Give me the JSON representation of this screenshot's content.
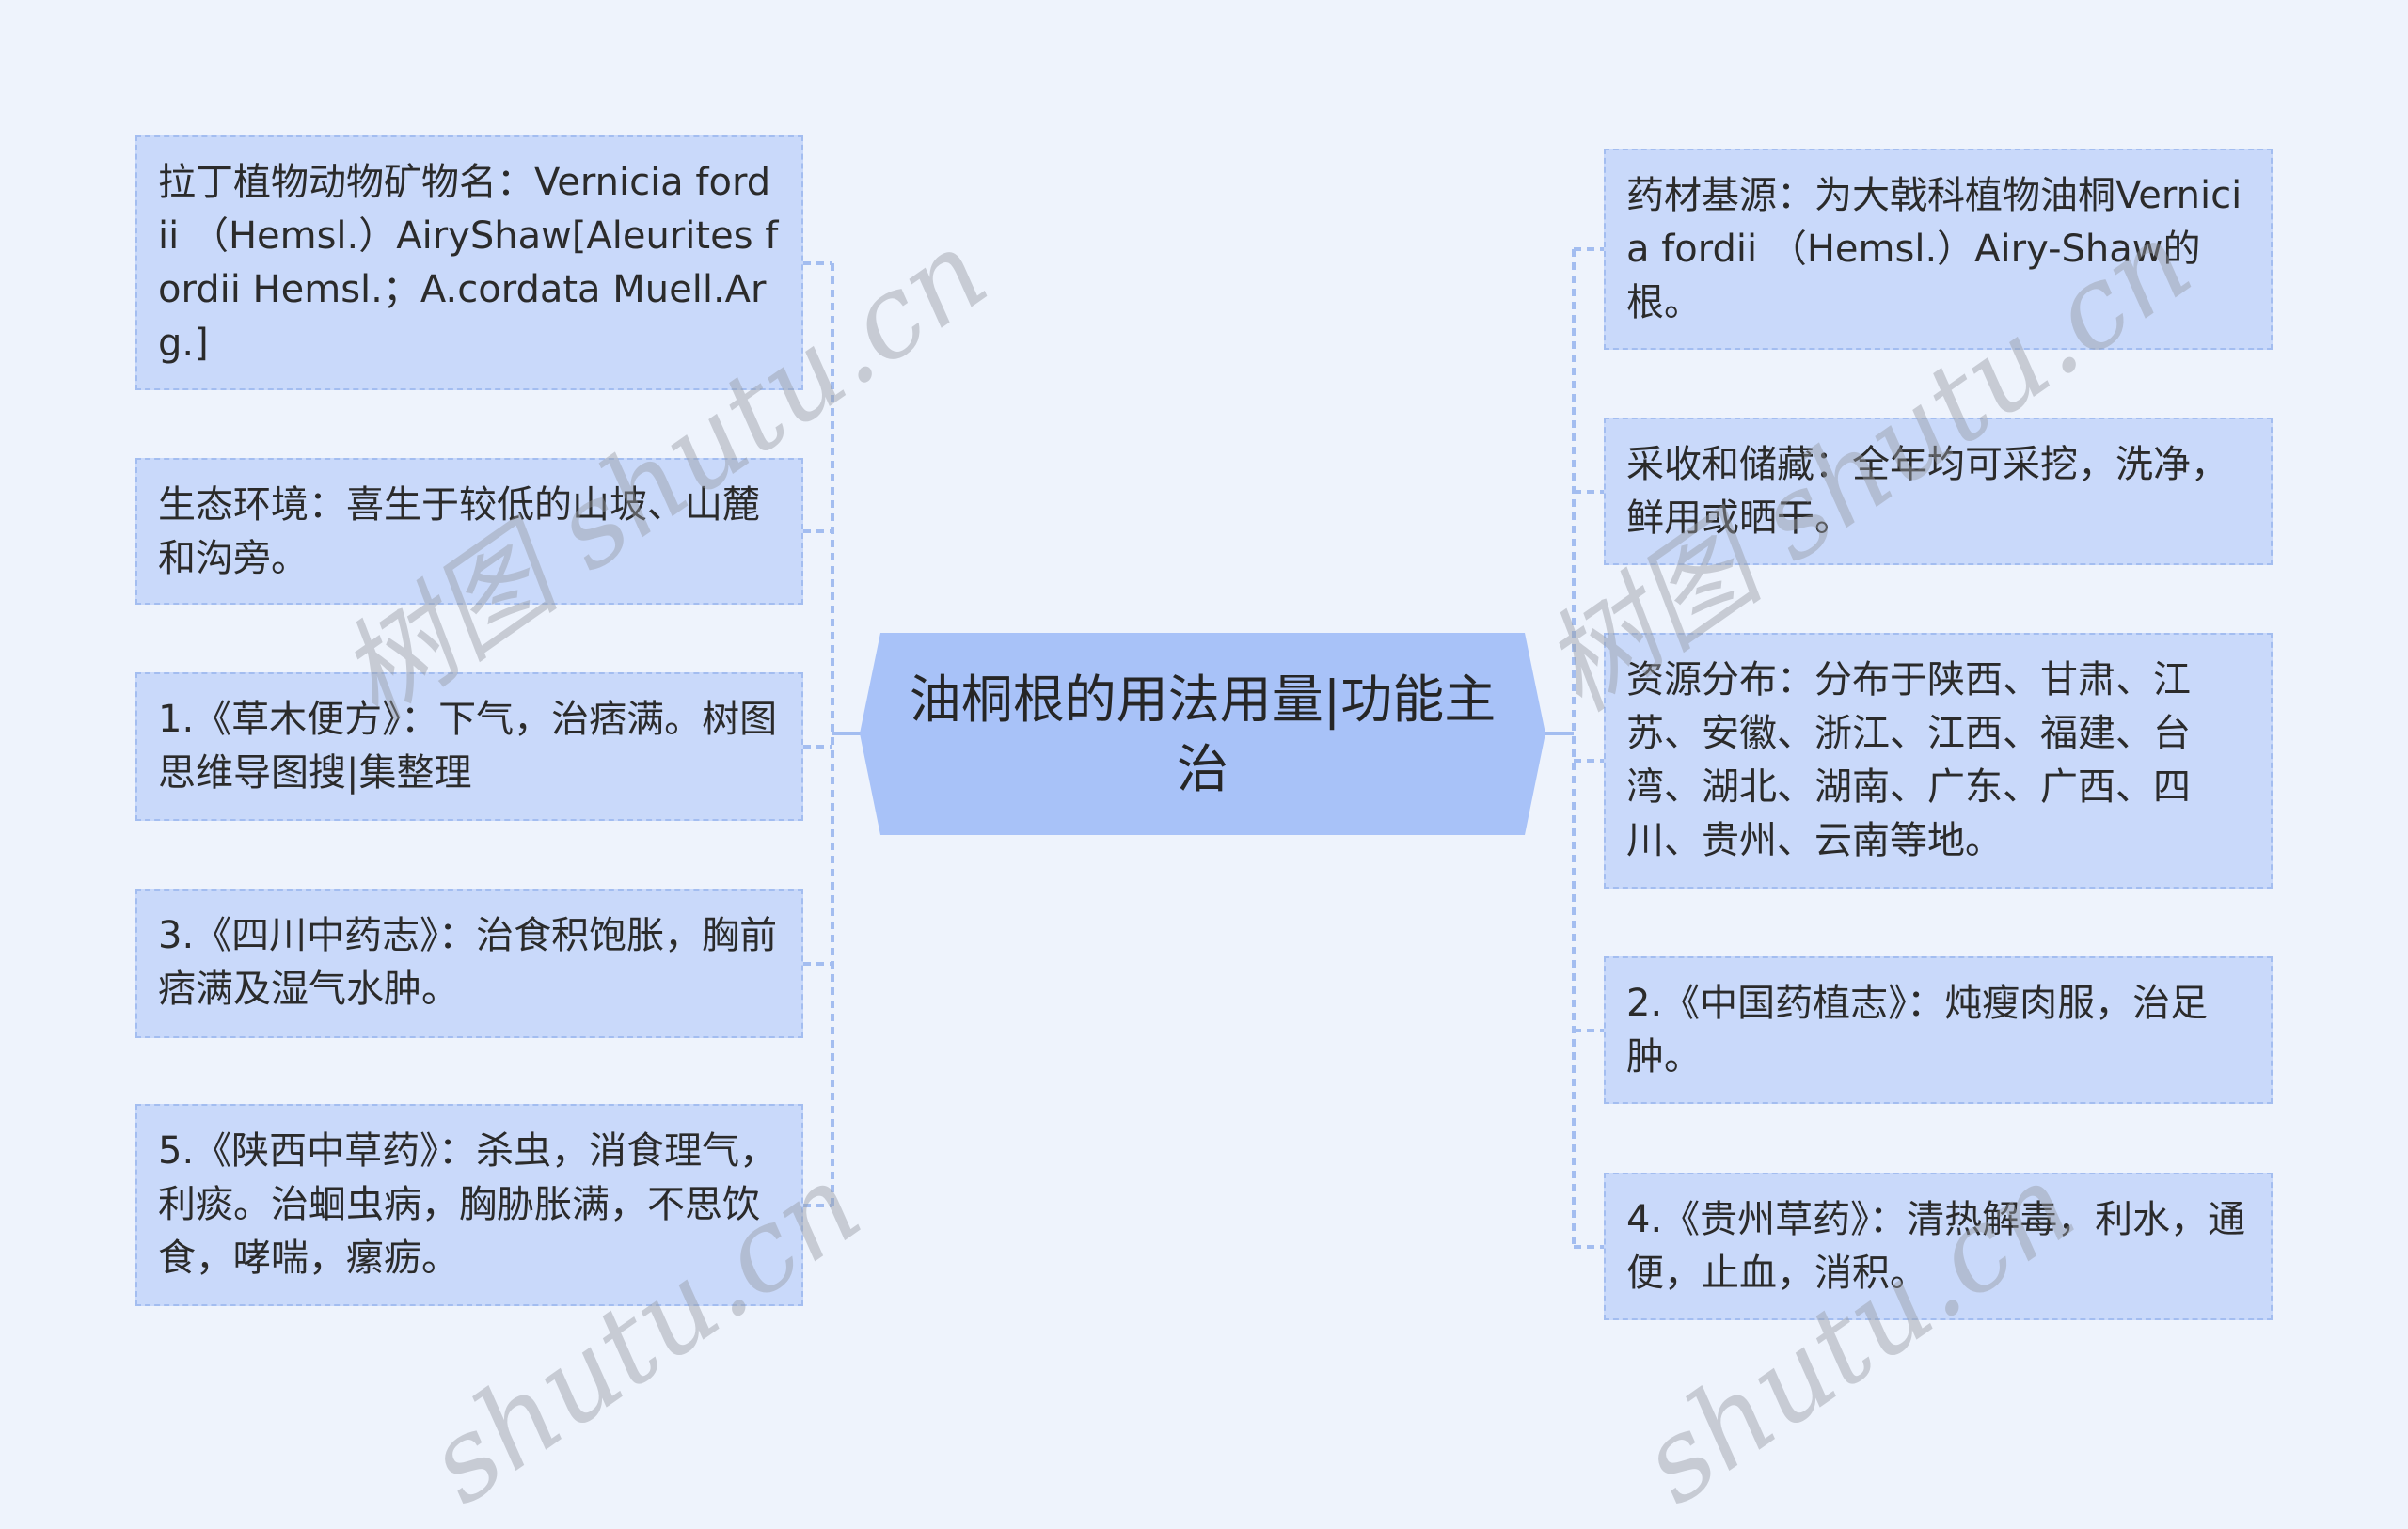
{
  "center": {
    "title": "油桐根的用法用量|功能主治"
  },
  "left_nodes": [
    {
      "text": "拉丁植物动物矿物名：Vernicia fordii （Hemsl.）AiryShaw[Aleurites fordii Hemsl.；A.cordata Muell.Arg.]"
    },
    {
      "text": "生态环境：喜生于较低的山坡、山麓和沟旁。"
    },
    {
      "text": "1.《草木便方》：下气，治痞满。树图思维导图搜|集整理"
    },
    {
      "text": "3.《四川中药志》：治食积饱胀，胸前痞满及湿气水肿。"
    },
    {
      "text": "5.《陕西中草药》：杀虫，消食理气，利痰。治蛔虫病，胸胁胀满，不思饮食，哮喘，瘰疬。"
    }
  ],
  "right_nodes": [
    {
      "text": "药材基源：为大戟科植物油桐Vernicia fordii （Hemsl.）Airy-Shaw的根。"
    },
    {
      "text": "采收和储藏：全年均可采挖，洗净，鲜用或晒干。"
    },
    {
      "text": "资源分布：分布于陕西、甘肃、江苏、安徽、浙江、江西、福建、台湾、湖北、湖南、广东、广西、四川、贵州、云南等地。"
    },
    {
      "text": "2.《中国药植志》：炖瘦肉服，治足肿。"
    },
    {
      "text": "4.《贵州草药》：清热解毒，利水，通便，止血，消积。"
    }
  ],
  "watermarks": [
    "树图 shutu.cn",
    "shutu.cn",
    "树图 shutu.cn",
    "shutu.cn"
  ],
  "colors": {
    "background": "#eef3fc",
    "node_fill": "#c9d9fa",
    "node_border": "#a3bdf0",
    "center_fill": "#a8c2f8",
    "connector": "#a3bdf0"
  }
}
